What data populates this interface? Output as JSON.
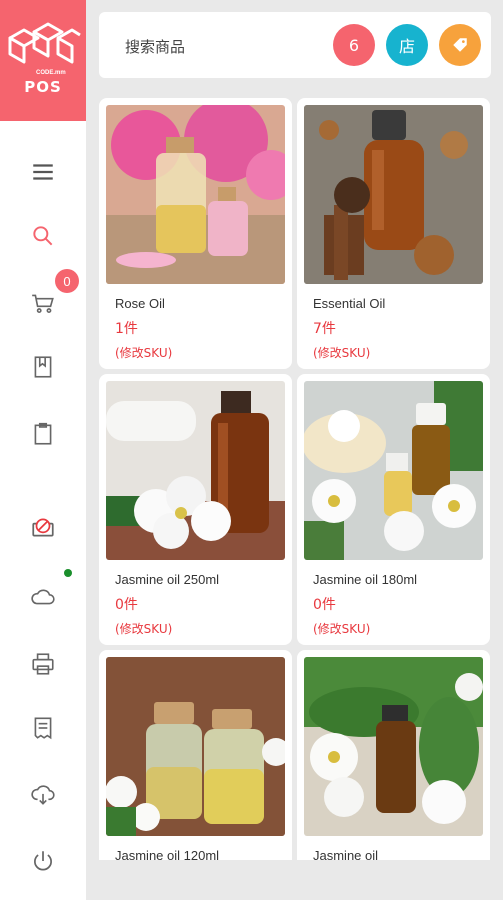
{
  "app": {
    "logo_text": "POS",
    "logo_sub": "CODE.mm"
  },
  "sidebar": {
    "items": [
      {
        "name": "menu",
        "icon": "menu-icon"
      },
      {
        "name": "search",
        "icon": "search-icon"
      },
      {
        "name": "cart",
        "icon": "cart-icon",
        "badge": "0"
      },
      {
        "name": "bookmark",
        "icon": "bookmark-icon"
      },
      {
        "name": "clipboard",
        "icon": "clipboard-icon"
      },
      {
        "name": "no-entry",
        "icon": "prohibited-icon"
      },
      {
        "name": "cloud",
        "icon": "cloud-icon"
      },
      {
        "name": "printer",
        "icon": "printer-icon"
      },
      {
        "name": "receipt",
        "icon": "receipt-icon"
      },
      {
        "name": "cloud-download",
        "icon": "cloud-download-icon"
      },
      {
        "name": "power",
        "icon": "power-icon"
      }
    ]
  },
  "search": {
    "placeholder": "搜索商品",
    "count_badge": "6",
    "store_label": "店",
    "tag_icon": "tag-icon"
  },
  "colors": {
    "brand": "#f5646e",
    "store": "#17b3cf",
    "tag": "#f7a23c",
    "price_red": "#e8393f"
  },
  "products": [
    {
      "name": "Rose Oil",
      "qty": "1件",
      "sku": "(修改SKU)"
    },
    {
      "name": "Essential Oil",
      "qty": "7件",
      "sku": "(修改SKU)"
    },
    {
      "name": "Jasmine oil 250ml",
      "qty": "0件",
      "sku": "(修改SKU)"
    },
    {
      "name": "Jasmine oil 180ml",
      "qty": "0件",
      "sku": "(修改SKU)"
    },
    {
      "name": "Jasmine oil 120ml",
      "qty": "",
      "sku": ""
    },
    {
      "name": "Jasmine oil",
      "qty": "",
      "sku": ""
    }
  ]
}
